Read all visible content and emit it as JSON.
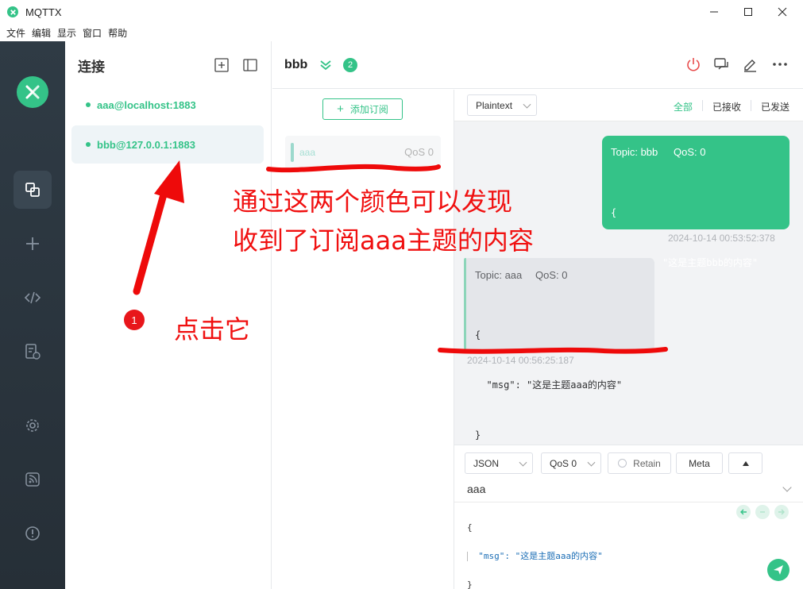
{
  "window": {
    "title": "MQTTX",
    "menu": [
      "文件",
      "编辑",
      "显示",
      "窗口",
      "帮助"
    ]
  },
  "sidebar": {
    "items": [
      {
        "icon": "connections-icon",
        "active": true
      },
      {
        "icon": "plus-icon"
      },
      {
        "icon": "code-icon"
      },
      {
        "icon": "log-icon"
      },
      {
        "icon": "gear-icon"
      },
      {
        "icon": "rss-icon"
      },
      {
        "icon": "info-icon"
      }
    ]
  },
  "connections": {
    "title": "连接",
    "items": [
      {
        "label": "aaa@localhost:1883",
        "active": false
      },
      {
        "label": "bbb@127.0.0.1:1883",
        "active": true
      }
    ]
  },
  "header": {
    "name": "bbb",
    "badge": "2",
    "icons": [
      "power-icon",
      "chat-icon",
      "edit-icon",
      "more-icon"
    ]
  },
  "subscriptions": {
    "add_label": "添加订阅",
    "items": [
      {
        "topic": "aaa",
        "qos": "QoS 0"
      }
    ]
  },
  "messages": {
    "format": "Plaintext",
    "filters": [
      "全部",
      "已接收",
      "已发送"
    ],
    "sent": {
      "topic": "Topic: bbb",
      "qos": "QoS: 0",
      "payload_lines": [
        "{",
        "  \"msg\": \"这是主题bbb的内容\"",
        "}"
      ],
      "time": "2024-10-14 00:53:52:378"
    },
    "received": {
      "topic": "Topic: aaa",
      "qos": "QoS: 0",
      "payload_lines": [
        "{",
        "  \"msg\": \"这是主题aaa的内容\"",
        "}"
      ],
      "time": "2024-10-14 00:56:25:187"
    }
  },
  "publish": {
    "format": "JSON",
    "qos": "QoS 0",
    "retain": "Retain",
    "meta": "Meta",
    "topic": "aaa",
    "payload_lines": [
      "{",
      "  \"msg\": \"这是主题aaa的内容\"",
      "}"
    ]
  },
  "annotations": {
    "line1": "通过这两个颜色可以发现",
    "line2": "收到了订阅aaa主题的内容",
    "click": "点击它",
    "step": "1"
  },
  "colors": {
    "accent": "#34c388",
    "nav_bg": "#2f3b45",
    "annotation": "#f01010"
  }
}
